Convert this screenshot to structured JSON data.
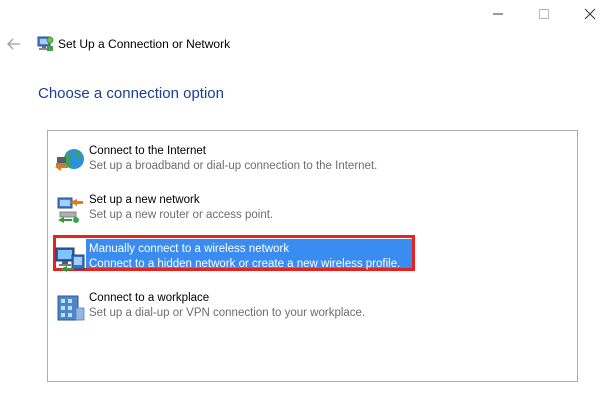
{
  "window": {
    "title": "Set Up a Connection or Network",
    "controls": [
      "minimize",
      "maximize",
      "close"
    ]
  },
  "heading": "Choose a connection option",
  "options": [
    {
      "title": "Connect to the Internet",
      "description": "Set up a broadband or dial-up connection to the Internet.",
      "icon": "globe-network-icon",
      "selected": false
    },
    {
      "title": "Set up a new network",
      "description": "Set up a new router or access point.",
      "icon": "router-setup-icon",
      "selected": false
    },
    {
      "title": "Manually connect to a wireless network",
      "description": "Connect to a hidden network or create a new wireless profile.",
      "icon": "wireless-monitor-icon",
      "selected": true
    },
    {
      "title": "Connect to a workplace",
      "description": "Set up a dial-up or VPN connection to your workplace.",
      "icon": "workplace-building-icon",
      "selected": false
    }
  ],
  "colors": {
    "heading": "#1c3f95",
    "selection_fill": "#3a8cf1",
    "highlight_border": "#e8231f"
  }
}
